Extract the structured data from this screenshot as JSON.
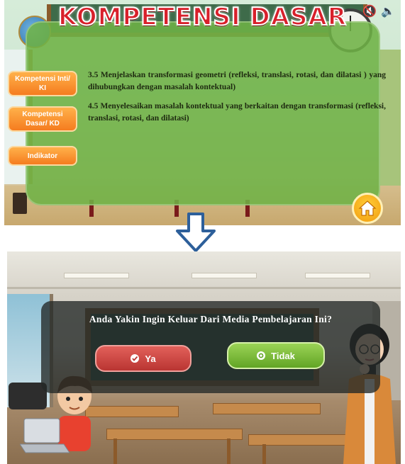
{
  "top_screen": {
    "title": "KOMPETENSI DASAR",
    "side_buttons": [
      {
        "label": "Kompetensi Inti/ KI"
      },
      {
        "label": "Kompetensi Dasar/ KD"
      },
      {
        "label": "Indikator"
      }
    ],
    "kd_items": [
      "3.5 Menjelaskan transformasi geometri (refleksi, translasi, rotasi, dan dilatasi ) yang dihubungkan dengan masalah kontektual)",
      "4.5 Menyelesaikan masalah kontektual yang berkaitan dengan transformasi (refleksi, translasi, rotasi, dan dilatasi)"
    ],
    "icons": {
      "mute": "mute-icon",
      "sound": "speaker-icon",
      "home": "home-icon"
    },
    "colors": {
      "panel": "#6eb246",
      "title": "#d8202b",
      "button": "#f57c1f",
      "home": "#f29b0c"
    }
  },
  "arrow": {
    "icon": "arrow-down-icon"
  },
  "bottom_screen": {
    "dialog_text": "Anda Yakin Ingin Keluar Dari Media Pembelajaran Ini?",
    "yes_label": "Ya",
    "no_label": "Tidak",
    "colors": {
      "yes": "#b93532",
      "no": "#62a525"
    }
  }
}
